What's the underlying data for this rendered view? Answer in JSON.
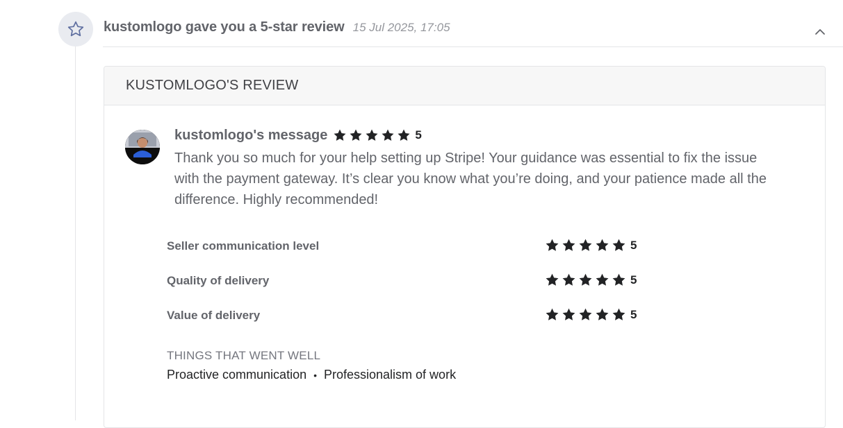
{
  "event": {
    "icon": "star-outline-icon",
    "title": "kustomlogo gave you a 5-star review",
    "date": "15 Jul 2025, 17:05",
    "collapse_icon": "chevron-up-icon"
  },
  "review": {
    "card_title": "KUSTOMLOGO'S REVIEW",
    "author_label": "kustomlogo's message",
    "overall_rating": "5",
    "message": "Thank you so much for your help setting up Stripe! Your guidance was essential to fix the issue with the payment gateway. It’s clear you know what you’re doing, and your patience made all the difference. Highly recommended!",
    "ratings": [
      {
        "label": "Seller communication level",
        "value": "5"
      },
      {
        "label": "Quality of delivery",
        "value": "5"
      },
      {
        "label": "Value of delivery",
        "value": "5"
      }
    ],
    "went_well_title": "THINGS THAT WENT WELL",
    "went_well_items": [
      "Proactive communication",
      "Professionalism of work"
    ],
    "went_well_separator": "•"
  },
  "colors": {
    "star": "#222325",
    "icon_bg": "#e9ebf0",
    "icon_stroke": "#5f6fa0"
  }
}
